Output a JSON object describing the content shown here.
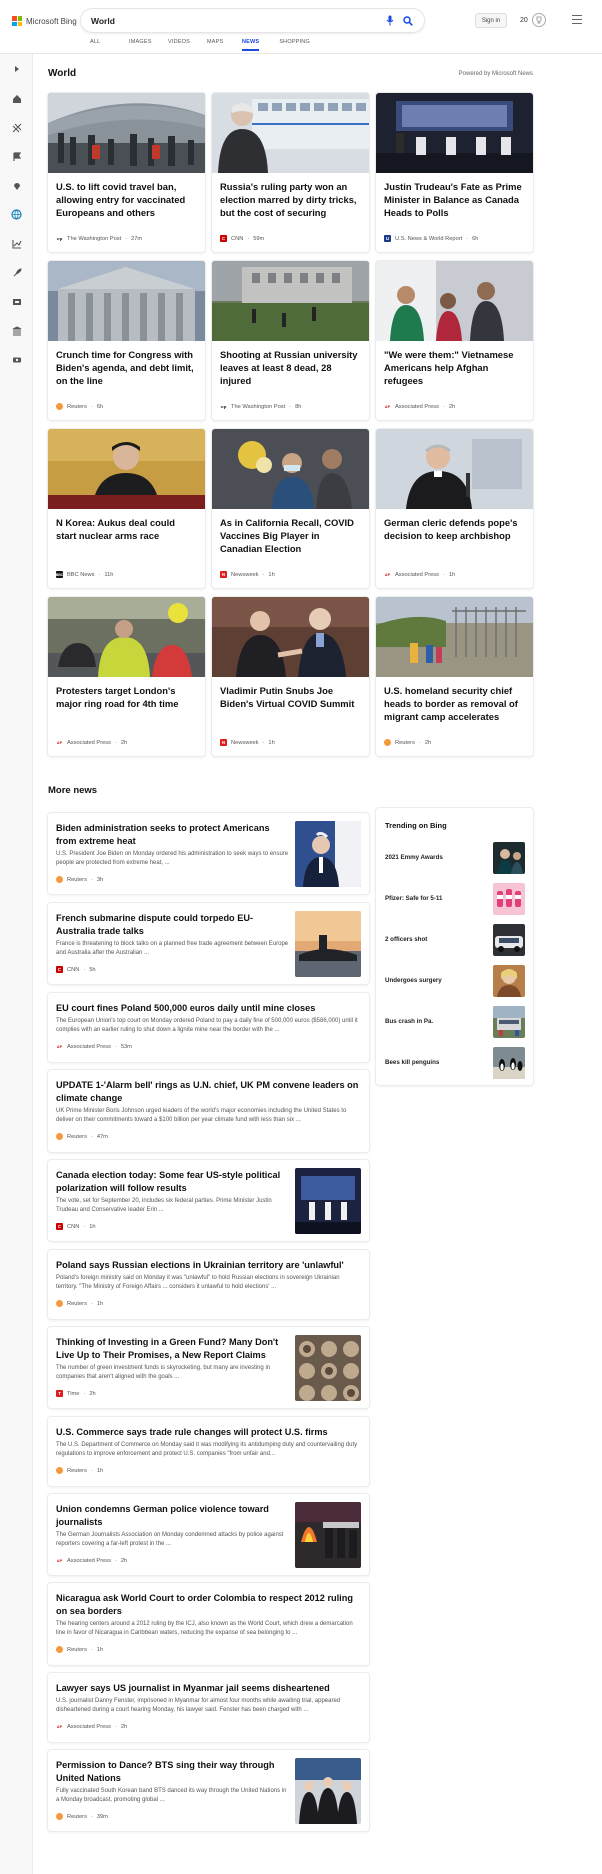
{
  "header": {
    "logo_text": "Microsoft Bing",
    "search_value": "World",
    "signin_label": "Sign in",
    "rewards_count": "20"
  },
  "tabs": [
    {
      "label": "ALL"
    },
    {
      "label": "IMAGES"
    },
    {
      "label": "VIDEOS"
    },
    {
      "label": "MAPS"
    },
    {
      "label": "NEWS"
    },
    {
      "label": "SHOPPING"
    }
  ],
  "colors": {
    "accent": "#174ae4"
  },
  "section": {
    "title": "World",
    "powered": "Powered by Microsoft News"
  },
  "top_cards": [
    {
      "title": "U.S. to lift covid travel ban, allowing entry for vaccinated Europeans and others",
      "source": "The Washington Post",
      "time": "27m",
      "badge": "wp"
    },
    {
      "title": "Russia's ruling party won an election marred by dirty tricks, but the cost of securing victor...",
      "source": "CNN",
      "time": "59m",
      "badge": "cnn"
    },
    {
      "title": "Justin Trudeau's Fate as Prime Minister in Balance as Canada Heads to Polls",
      "source": "U.S. News & World Report",
      "time": "6h",
      "badge": "usn"
    },
    {
      "title": "Crunch time for Congress with Biden's agenda, and debt limit, on the line",
      "source": "Reuters",
      "time": "6h",
      "badge": "reuters"
    },
    {
      "title": "Shooting at Russian university leaves at least 8 dead, 28 injured",
      "source": "The Washington Post",
      "time": "8h",
      "badge": "wp"
    },
    {
      "title": "\"We were them:\" Vietnamese Americans help Afghan refugees",
      "source": "Associated Press",
      "time": "2h",
      "badge": "ap"
    },
    {
      "title": "N Korea: Aukus deal could start nuclear arms race",
      "source": "BBC News",
      "time": "11h",
      "badge": "bbc"
    },
    {
      "title": "As in California Recall, COVID Vaccines Big Player in Canadian Election",
      "source": "Newsweek",
      "time": "1h",
      "badge": "nw"
    },
    {
      "title": "German cleric defends pope's decision to keep archbishop",
      "source": "Associated Press",
      "time": "1h",
      "badge": "ap"
    },
    {
      "title": "Protesters target London's major ring road for 4th time",
      "source": "Associated Press",
      "time": "2h",
      "badge": "ap"
    },
    {
      "title": "Vladimir Putin Snubs Joe Biden's Virtual COVID Summit",
      "source": "Newsweek",
      "time": "1h",
      "badge": "nw"
    },
    {
      "title": "U.S. homeland security chief heads to border as removal of migrant camp accelerates",
      "source": "Reuters",
      "time": "2h",
      "badge": "reuters"
    }
  ],
  "more_news_title": "More news",
  "more_news": [
    {
      "title": "Biden administration seeks to protect Americans from extreme heat",
      "desc": "U.S. President Joe Biden on Monday ordered his administration to seek ways to ensure people are protected from extreme heat, ...",
      "source": "Reuters",
      "time": "3h",
      "badge": "reuters",
      "thumb": true
    },
    {
      "title": "French submarine dispute could torpedo EU-Australia trade talks",
      "desc": "France is threatening to block talks on a planned free trade agreement between Europe and Australia after the Australian ...",
      "source": "CNN",
      "time": "5h",
      "badge": "cnn",
      "thumb": true
    },
    {
      "title": "EU court fines Poland 500,000 euros daily until mine closes",
      "desc": "The European Union's top court on Monday ordered Poland to pay a daily fine of 500,000 euros ($586,000) until it complies with an earlier ruling to shut down a lignite mine near the border with the ...",
      "source": "Associated Press",
      "time": "53m",
      "badge": "ap",
      "thumb": false
    },
    {
      "title": "UPDATE 1-'Alarm bell' rings as U.N. chief, UK PM convene leaders on climate change",
      "desc": "UK Prime Minister Boris Johnson urged leaders of the world's major economies including the United States to deliver on their commitments toward a $100 billion per year climate fund with less than six ...",
      "source": "Reuters",
      "time": "47m",
      "badge": "reuters",
      "thumb": false
    },
    {
      "title": "Canada election today: Some fear US-style political polarization will follow results",
      "desc": "The vote, set for September 20, includes six federal parties. Prime Minister Justin Trudeau and Conservative leader Erin ...",
      "source": "CNN",
      "time": "1h",
      "badge": "cnn",
      "thumb": true
    },
    {
      "title": "Poland says Russian elections in Ukrainian territory are 'unlawful'",
      "desc": "Poland's foreign ministry said on Monday it was \"unlawful\" to hold Russian elections in sovereign Ukrainian territory. \"The Ministry of Foreign Affairs ... considers it unlawful to hold elections' ...",
      "source": "Reuters",
      "time": "1h",
      "badge": "reuters",
      "thumb": false
    },
    {
      "title": "Thinking of Investing in a Green Fund? Many Don't Live Up to Their Promises, a New Report Claims",
      "desc": "The number of green investment funds is skyrocketing, but many are investing in companies that aren't aligned with the goals ...",
      "source": "Time",
      "time": "2h",
      "badge": "time",
      "thumb": true
    },
    {
      "title": "U.S. Commerce says trade rule changes will protect U.S. firms",
      "desc": "The U.S. Department of Commerce on Monday said it was modifying its antidumping duty and countervailing duty regulations to improve enforcement and protect U.S. companies \"from unfair and...",
      "source": "Reuters",
      "time": "1h",
      "badge": "reuters",
      "thumb": false
    },
    {
      "title": "Union condemns German police violence toward journalists",
      "desc": "The German Journalists Association on Monday condemned attacks by police against reporters covering a far-left protest in the ...",
      "source": "Associated Press",
      "time": "2h",
      "badge": "ap",
      "thumb": true
    },
    {
      "title": "Nicaragua ask World Court to order Colombia to respect 2012 ruling on sea borders",
      "desc": "The hearing centers around a 2012 ruling by the ICJ, also known as the World Court, which drew a demarcation line in favor of Nicaragua in Caribbean waters, reducing the expanse of sea belonging to ...",
      "source": "Reuters",
      "time": "1h",
      "badge": "reuters",
      "thumb": false
    },
    {
      "title": "Lawyer says US journalist in Myanmar jail seems disheartened",
      "desc": "U.S. journalist Danny Fenster, imprisoned in Myanmar for almost four months while awaiting trial, appeared disheartened during a court hearing Monday, his lawyer said. Fenster has been charged with ...",
      "source": "Associated Press",
      "time": "2h",
      "badge": "ap",
      "thumb": false
    },
    {
      "title": "Permission to Dance? BTS sing their way through United Nations",
      "desc": "Fully vaccinated South Korean band BTS danced its way through the United Nations in a Monday broadcast, promoting global ...",
      "source": "Reuters",
      "time": "39m",
      "badge": "reuters",
      "thumb": true
    }
  ],
  "trending": {
    "title": "Trending on Bing",
    "items": [
      {
        "label": "2021 Emmy Awards"
      },
      {
        "label": "Pfizer: Safe for 5-11"
      },
      {
        "label": "2 officers shot"
      },
      {
        "label": "Undergoes surgery"
      },
      {
        "label": "Bus crash in Pa."
      },
      {
        "label": "Bees kill penguins"
      }
    ]
  }
}
